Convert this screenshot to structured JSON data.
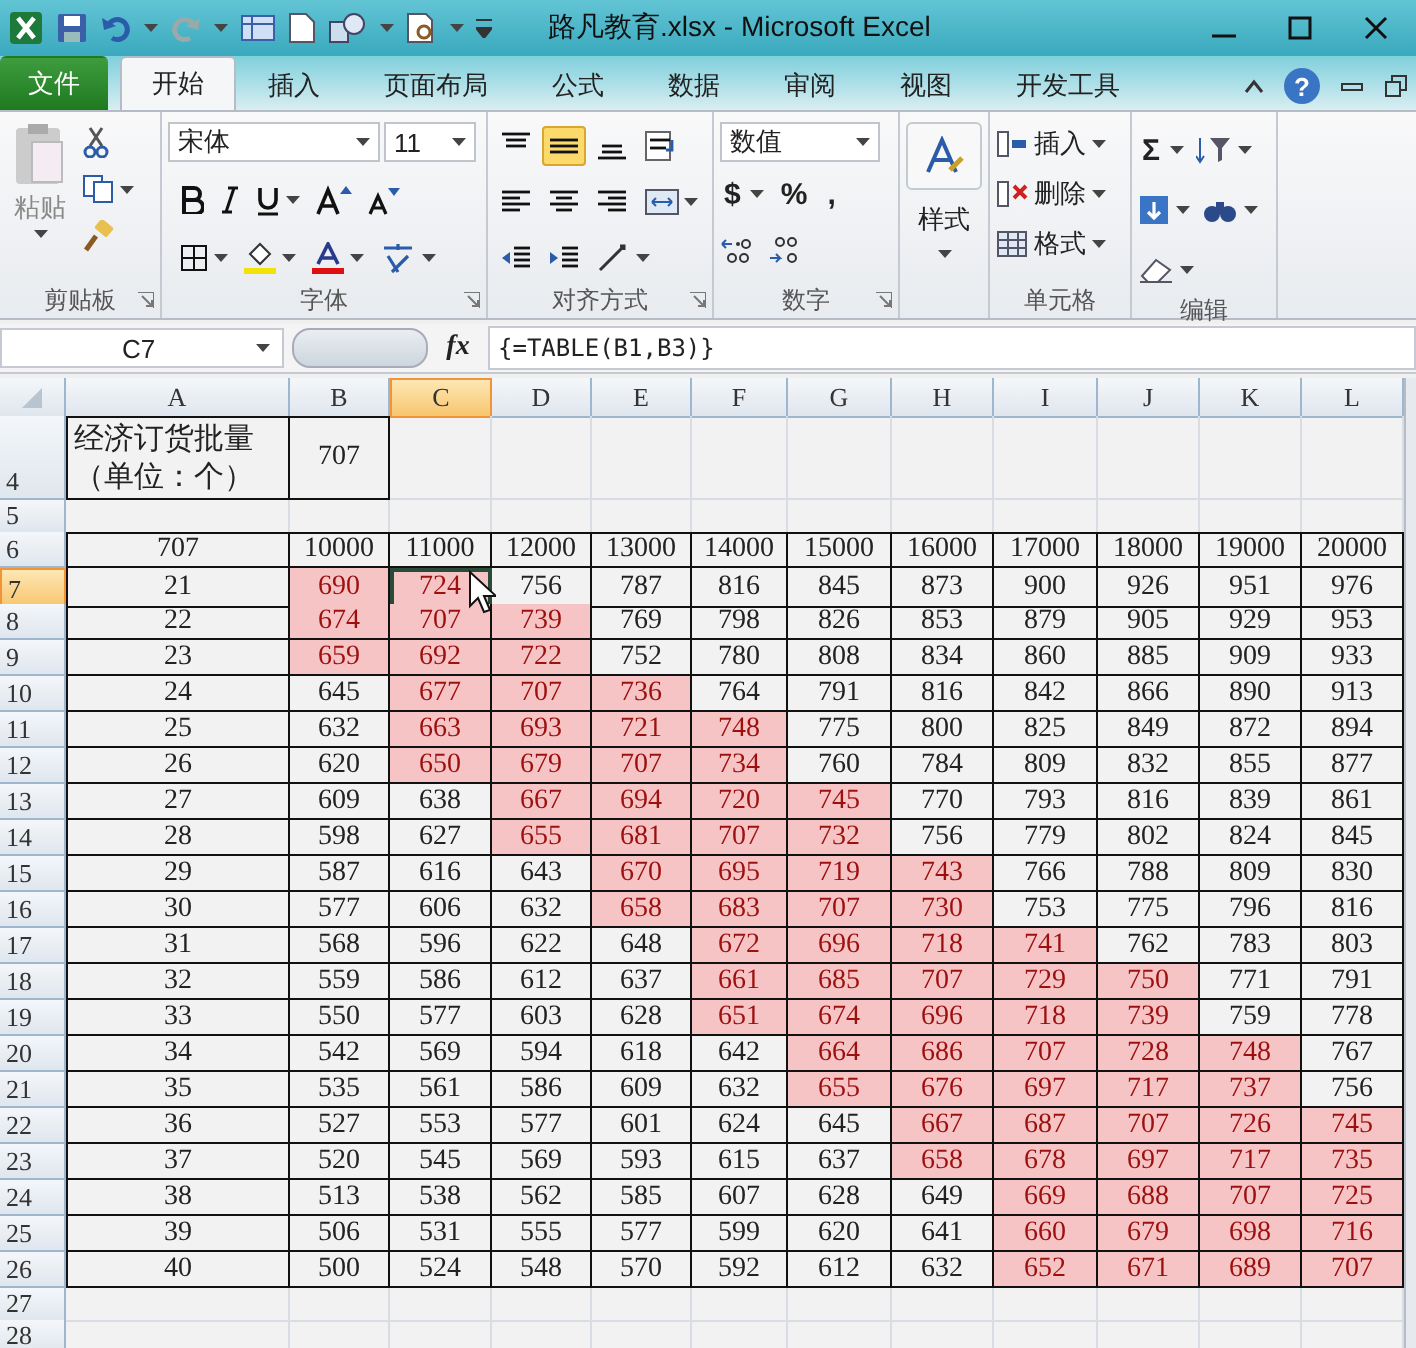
{
  "window": {
    "title": "路凡教育.xlsx - Microsoft Excel"
  },
  "ribbon_tabs": [
    {
      "label": "文件",
      "kind": "file",
      "selected": false
    },
    {
      "label": "开始",
      "kind": "tab",
      "selected": true
    },
    {
      "label": "插入",
      "kind": "tab",
      "selected": false
    },
    {
      "label": "页面布局",
      "kind": "tab",
      "selected": false
    },
    {
      "label": "公式",
      "kind": "tab",
      "selected": false
    },
    {
      "label": "数据",
      "kind": "tab",
      "selected": false
    },
    {
      "label": "审阅",
      "kind": "tab",
      "selected": false
    },
    {
      "label": "视图",
      "kind": "tab",
      "selected": false
    },
    {
      "label": "开发工具",
      "kind": "tab",
      "selected": false
    }
  ],
  "help": "?",
  "ribbon": {
    "clipboard": {
      "paste": "粘贴",
      "label": "剪贴板"
    },
    "font": {
      "name": "宋体",
      "size": "11",
      "label": "字体"
    },
    "alignment": {
      "label": "对齐方式",
      "buttons": [
        {
          "kind": "top",
          "on": false
        },
        {
          "kind": "middle",
          "on": true
        },
        {
          "kind": "bottom",
          "on": false
        },
        {
          "kind": "wrap",
          "on": false
        },
        {
          "kind": "left",
          "on": false
        },
        {
          "kind": "center",
          "on": false
        },
        {
          "kind": "right",
          "on": false
        },
        {
          "kind": "merge",
          "on": false
        },
        {
          "kind": "outdent",
          "on": false
        },
        {
          "kind": "indent",
          "on": false
        },
        {
          "kind": "orient",
          "on": false
        }
      ]
    },
    "number": {
      "format": "数值",
      "currency": "$",
      "percent": "%",
      "comma": ",",
      "label": "数字"
    },
    "styles": {
      "button": "样式"
    },
    "cells": {
      "insert": "插入",
      "delete": "删除",
      "format": "格式",
      "label": "单元格"
    },
    "editing": {
      "sum": "Σ",
      "label": "编辑"
    }
  },
  "formula_bar": {
    "name_box": "C7",
    "function_button": "fx",
    "formula": "{=TABLE(B1,B3)}"
  },
  "sheet": {
    "columns": [
      {
        "label": "A",
        "selected": false
      },
      {
        "label": "B",
        "selected": false
      },
      {
        "label": "C",
        "selected": true
      },
      {
        "label": "D",
        "selected": false
      },
      {
        "label": "E",
        "selected": false
      },
      {
        "label": "F",
        "selected": false
      },
      {
        "label": "G",
        "selected": false
      },
      {
        "label": "H",
        "selected": false
      },
      {
        "label": "I",
        "selected": false
      },
      {
        "label": "J",
        "selected": false
      },
      {
        "label": "K",
        "selected": false
      },
      {
        "label": "L",
        "selected": false
      }
    ],
    "rows": [
      {
        "number": "4",
        "kind": "input",
        "selected": false,
        "cells": [
          {
            "text": "经济订货批量（单位：个）",
            "highlighted": false
          },
          {
            "text": "707",
            "highlighted": false
          }
        ]
      },
      {
        "number": "5",
        "kind": "blank",
        "selected": false
      },
      {
        "number": "6",
        "kind": "header",
        "selected": false,
        "cells": [
          {
            "text": "707",
            "highlighted": false
          },
          {
            "text": "10000",
            "highlighted": false
          },
          {
            "text": "11000",
            "highlighted": false
          },
          {
            "text": "12000",
            "highlighted": false
          },
          {
            "text": "13000",
            "highlighted": false
          },
          {
            "text": "14000",
            "highlighted": false
          },
          {
            "text": "15000",
            "highlighted": false
          },
          {
            "text": "16000",
            "highlighted": false
          },
          {
            "text": "17000",
            "highlighted": false
          },
          {
            "text": "18000",
            "highlighted": false
          },
          {
            "text": "19000",
            "highlighted": false
          },
          {
            "text": "20000",
            "highlighted": false
          }
        ]
      },
      {
        "number": "7",
        "kind": "data",
        "selected": true,
        "cells": [
          {
            "text": "21",
            "highlighted": false
          },
          {
            "text": "690",
            "highlighted": true
          },
          {
            "text": "724",
            "highlighted": true
          },
          {
            "text": "756",
            "highlighted": false
          },
          {
            "text": "787",
            "highlighted": false
          },
          {
            "text": "816",
            "highlighted": false
          },
          {
            "text": "845",
            "highlighted": false
          },
          {
            "text": "873",
            "highlighted": false
          },
          {
            "text": "900",
            "highlighted": false
          },
          {
            "text": "926",
            "highlighted": false
          },
          {
            "text": "951",
            "highlighted": false
          },
          {
            "text": "976",
            "highlighted": false
          }
        ]
      },
      {
        "number": "8",
        "kind": "data",
        "selected": false,
        "cells": [
          {
            "text": "22",
            "highlighted": false
          },
          {
            "text": "674",
            "highlighted": true
          },
          {
            "text": "707",
            "highlighted": true
          },
          {
            "text": "739",
            "highlighted": true
          },
          {
            "text": "769",
            "highlighted": false
          },
          {
            "text": "798",
            "highlighted": false
          },
          {
            "text": "826",
            "highlighted": false
          },
          {
            "text": "853",
            "highlighted": false
          },
          {
            "text": "879",
            "highlighted": false
          },
          {
            "text": "905",
            "highlighted": false
          },
          {
            "text": "929",
            "highlighted": false
          },
          {
            "text": "953",
            "highlighted": false
          }
        ]
      },
      {
        "number": "9",
        "kind": "data",
        "selected": false,
        "cells": [
          {
            "text": "23",
            "highlighted": false
          },
          {
            "text": "659",
            "highlighted": true
          },
          {
            "text": "692",
            "highlighted": true
          },
          {
            "text": "722",
            "highlighted": true
          },
          {
            "text": "752",
            "highlighted": false
          },
          {
            "text": "780",
            "highlighted": false
          },
          {
            "text": "808",
            "highlighted": false
          },
          {
            "text": "834",
            "highlighted": false
          },
          {
            "text": "860",
            "highlighted": false
          },
          {
            "text": "885",
            "highlighted": false
          },
          {
            "text": "909",
            "highlighted": false
          },
          {
            "text": "933",
            "highlighted": false
          }
        ]
      },
      {
        "number": "10",
        "kind": "data",
        "selected": false,
        "cells": [
          {
            "text": "24",
            "highlighted": false
          },
          {
            "text": "645",
            "highlighted": false
          },
          {
            "text": "677",
            "highlighted": true
          },
          {
            "text": "707",
            "highlighted": true
          },
          {
            "text": "736",
            "highlighted": true
          },
          {
            "text": "764",
            "highlighted": false
          },
          {
            "text": "791",
            "highlighted": false
          },
          {
            "text": "816",
            "highlighted": false
          },
          {
            "text": "842",
            "highlighted": false
          },
          {
            "text": "866",
            "highlighted": false
          },
          {
            "text": "890",
            "highlighted": false
          },
          {
            "text": "913",
            "highlighted": false
          }
        ]
      },
      {
        "number": "11",
        "kind": "data",
        "selected": false,
        "cells": [
          {
            "text": "25",
            "highlighted": false
          },
          {
            "text": "632",
            "highlighted": false
          },
          {
            "text": "663",
            "highlighted": true
          },
          {
            "text": "693",
            "highlighted": true
          },
          {
            "text": "721",
            "highlighted": true
          },
          {
            "text": "748",
            "highlighted": true
          },
          {
            "text": "775",
            "highlighted": false
          },
          {
            "text": "800",
            "highlighted": false
          },
          {
            "text": "825",
            "highlighted": false
          },
          {
            "text": "849",
            "highlighted": false
          },
          {
            "text": "872",
            "highlighted": false
          },
          {
            "text": "894",
            "highlighted": false
          }
        ]
      },
      {
        "number": "12",
        "kind": "data",
        "selected": false,
        "cells": [
          {
            "text": "26",
            "highlighted": false
          },
          {
            "text": "620",
            "highlighted": false
          },
          {
            "text": "650",
            "highlighted": true
          },
          {
            "text": "679",
            "highlighted": true
          },
          {
            "text": "707",
            "highlighted": true
          },
          {
            "text": "734",
            "highlighted": true
          },
          {
            "text": "760",
            "highlighted": false
          },
          {
            "text": "784",
            "highlighted": false
          },
          {
            "text": "809",
            "highlighted": false
          },
          {
            "text": "832",
            "highlighted": false
          },
          {
            "text": "855",
            "highlighted": false
          },
          {
            "text": "877",
            "highlighted": false
          }
        ]
      },
      {
        "number": "13",
        "kind": "data",
        "selected": false,
        "cells": [
          {
            "text": "27",
            "highlighted": false
          },
          {
            "text": "609",
            "highlighted": false
          },
          {
            "text": "638",
            "highlighted": false
          },
          {
            "text": "667",
            "highlighted": true
          },
          {
            "text": "694",
            "highlighted": true
          },
          {
            "text": "720",
            "highlighted": true
          },
          {
            "text": "745",
            "highlighted": true
          },
          {
            "text": "770",
            "highlighted": false
          },
          {
            "text": "793",
            "highlighted": false
          },
          {
            "text": "816",
            "highlighted": false
          },
          {
            "text": "839",
            "highlighted": false
          },
          {
            "text": "861",
            "highlighted": false
          }
        ]
      },
      {
        "number": "14",
        "kind": "data",
        "selected": false,
        "cells": [
          {
            "text": "28",
            "highlighted": false
          },
          {
            "text": "598",
            "highlighted": false
          },
          {
            "text": "627",
            "highlighted": false
          },
          {
            "text": "655",
            "highlighted": true
          },
          {
            "text": "681",
            "highlighted": true
          },
          {
            "text": "707",
            "highlighted": true
          },
          {
            "text": "732",
            "highlighted": true
          },
          {
            "text": "756",
            "highlighted": false
          },
          {
            "text": "779",
            "highlighted": false
          },
          {
            "text": "802",
            "highlighted": false
          },
          {
            "text": "824",
            "highlighted": false
          },
          {
            "text": "845",
            "highlighted": false
          }
        ]
      },
      {
        "number": "15",
        "kind": "data",
        "selected": false,
        "cells": [
          {
            "text": "29",
            "highlighted": false
          },
          {
            "text": "587",
            "highlighted": false
          },
          {
            "text": "616",
            "highlighted": false
          },
          {
            "text": "643",
            "highlighted": false
          },
          {
            "text": "670",
            "highlighted": true
          },
          {
            "text": "695",
            "highlighted": true
          },
          {
            "text": "719",
            "highlighted": true
          },
          {
            "text": "743",
            "highlighted": true
          },
          {
            "text": "766",
            "highlighted": false
          },
          {
            "text": "788",
            "highlighted": false
          },
          {
            "text": "809",
            "highlighted": false
          },
          {
            "text": "830",
            "highlighted": false
          }
        ]
      },
      {
        "number": "16",
        "kind": "data",
        "selected": false,
        "cells": [
          {
            "text": "30",
            "highlighted": false
          },
          {
            "text": "577",
            "highlighted": false
          },
          {
            "text": "606",
            "highlighted": false
          },
          {
            "text": "632",
            "highlighted": false
          },
          {
            "text": "658",
            "highlighted": true
          },
          {
            "text": "683",
            "highlighted": true
          },
          {
            "text": "707",
            "highlighted": true
          },
          {
            "text": "730",
            "highlighted": true
          },
          {
            "text": "753",
            "highlighted": false
          },
          {
            "text": "775",
            "highlighted": false
          },
          {
            "text": "796",
            "highlighted": false
          },
          {
            "text": "816",
            "highlighted": false
          }
        ]
      },
      {
        "number": "17",
        "kind": "data",
        "selected": false,
        "cells": [
          {
            "text": "31",
            "highlighted": false
          },
          {
            "text": "568",
            "highlighted": false
          },
          {
            "text": "596",
            "highlighted": false
          },
          {
            "text": "622",
            "highlighted": false
          },
          {
            "text": "648",
            "highlighted": false
          },
          {
            "text": "672",
            "highlighted": true
          },
          {
            "text": "696",
            "highlighted": true
          },
          {
            "text": "718",
            "highlighted": true
          },
          {
            "text": "741",
            "highlighted": true
          },
          {
            "text": "762",
            "highlighted": false
          },
          {
            "text": "783",
            "highlighted": false
          },
          {
            "text": "803",
            "highlighted": false
          }
        ]
      },
      {
        "number": "18",
        "kind": "data",
        "selected": false,
        "cells": [
          {
            "text": "32",
            "highlighted": false
          },
          {
            "text": "559",
            "highlighted": false
          },
          {
            "text": "586",
            "highlighted": false
          },
          {
            "text": "612",
            "highlighted": false
          },
          {
            "text": "637",
            "highlighted": false
          },
          {
            "text": "661",
            "highlighted": true
          },
          {
            "text": "685",
            "highlighted": true
          },
          {
            "text": "707",
            "highlighted": true
          },
          {
            "text": "729",
            "highlighted": true
          },
          {
            "text": "750",
            "highlighted": true
          },
          {
            "text": "771",
            "highlighted": false
          },
          {
            "text": "791",
            "highlighted": false
          }
        ]
      },
      {
        "number": "19",
        "kind": "data",
        "selected": false,
        "cells": [
          {
            "text": "33",
            "highlighted": false
          },
          {
            "text": "550",
            "highlighted": false
          },
          {
            "text": "577",
            "highlighted": false
          },
          {
            "text": "603",
            "highlighted": false
          },
          {
            "text": "628",
            "highlighted": false
          },
          {
            "text": "651",
            "highlighted": true
          },
          {
            "text": "674",
            "highlighted": true
          },
          {
            "text": "696",
            "highlighted": true
          },
          {
            "text": "718",
            "highlighted": true
          },
          {
            "text": "739",
            "highlighted": true
          },
          {
            "text": "759",
            "highlighted": false
          },
          {
            "text": "778",
            "highlighted": false
          }
        ]
      },
      {
        "number": "20",
        "kind": "data",
        "selected": false,
        "cells": [
          {
            "text": "34",
            "highlighted": false
          },
          {
            "text": "542",
            "highlighted": false
          },
          {
            "text": "569",
            "highlighted": false
          },
          {
            "text": "594",
            "highlighted": false
          },
          {
            "text": "618",
            "highlighted": false
          },
          {
            "text": "642",
            "highlighted": false
          },
          {
            "text": "664",
            "highlighted": true
          },
          {
            "text": "686",
            "highlighted": true
          },
          {
            "text": "707",
            "highlighted": true
          },
          {
            "text": "728",
            "highlighted": true
          },
          {
            "text": "748",
            "highlighted": true
          },
          {
            "text": "767",
            "highlighted": false
          }
        ]
      },
      {
        "number": "21",
        "kind": "data",
        "selected": false,
        "cells": [
          {
            "text": "35",
            "highlighted": false
          },
          {
            "text": "535",
            "highlighted": false
          },
          {
            "text": "561",
            "highlighted": false
          },
          {
            "text": "586",
            "highlighted": false
          },
          {
            "text": "609",
            "highlighted": false
          },
          {
            "text": "632",
            "highlighted": false
          },
          {
            "text": "655",
            "highlighted": true
          },
          {
            "text": "676",
            "highlighted": true
          },
          {
            "text": "697",
            "highlighted": true
          },
          {
            "text": "717",
            "highlighted": true
          },
          {
            "text": "737",
            "highlighted": true
          },
          {
            "text": "756",
            "highlighted": false
          }
        ]
      },
      {
        "number": "22",
        "kind": "data",
        "selected": false,
        "cells": [
          {
            "text": "36",
            "highlighted": false
          },
          {
            "text": "527",
            "highlighted": false
          },
          {
            "text": "553",
            "highlighted": false
          },
          {
            "text": "577",
            "highlighted": false
          },
          {
            "text": "601",
            "highlighted": false
          },
          {
            "text": "624",
            "highlighted": false
          },
          {
            "text": "645",
            "highlighted": false
          },
          {
            "text": "667",
            "highlighted": true
          },
          {
            "text": "687",
            "highlighted": true
          },
          {
            "text": "707",
            "highlighted": true
          },
          {
            "text": "726",
            "highlighted": true
          },
          {
            "text": "745",
            "highlighted": true
          }
        ]
      },
      {
        "number": "23",
        "kind": "data",
        "selected": false,
        "cells": [
          {
            "text": "37",
            "highlighted": false
          },
          {
            "text": "520",
            "highlighted": false
          },
          {
            "text": "545",
            "highlighted": false
          },
          {
            "text": "569",
            "highlighted": false
          },
          {
            "text": "593",
            "highlighted": false
          },
          {
            "text": "615",
            "highlighted": false
          },
          {
            "text": "637",
            "highlighted": false
          },
          {
            "text": "658",
            "highlighted": true
          },
          {
            "text": "678",
            "highlighted": true
          },
          {
            "text": "697",
            "highlighted": true
          },
          {
            "text": "717",
            "highlighted": true
          },
          {
            "text": "735",
            "highlighted": true
          }
        ]
      },
      {
        "number": "24",
        "kind": "data",
        "selected": false,
        "cells": [
          {
            "text": "38",
            "highlighted": false
          },
          {
            "text": "513",
            "highlighted": false
          },
          {
            "text": "538",
            "highlighted": false
          },
          {
            "text": "562",
            "highlighted": false
          },
          {
            "text": "585",
            "highlighted": false
          },
          {
            "text": "607",
            "highlighted": false
          },
          {
            "text": "628",
            "highlighted": false
          },
          {
            "text": "649",
            "highlighted": false
          },
          {
            "text": "669",
            "highlighted": true
          },
          {
            "text": "688",
            "highlighted": true
          },
          {
            "text": "707",
            "highlighted": true
          },
          {
            "text": "725",
            "highlighted": true
          }
        ]
      },
      {
        "number": "25",
        "kind": "data",
        "selected": false,
        "cells": [
          {
            "text": "39",
            "highlighted": false
          },
          {
            "text": "506",
            "highlighted": false
          },
          {
            "text": "531",
            "highlighted": false
          },
          {
            "text": "555",
            "highlighted": false
          },
          {
            "text": "577",
            "highlighted": false
          },
          {
            "text": "599",
            "highlighted": false
          },
          {
            "text": "620",
            "highlighted": false
          },
          {
            "text": "641",
            "highlighted": false
          },
          {
            "text": "660",
            "highlighted": true
          },
          {
            "text": "679",
            "highlighted": true
          },
          {
            "text": "698",
            "highlighted": true
          },
          {
            "text": "716",
            "highlighted": true
          }
        ]
      },
      {
        "number": "26",
        "kind": "data",
        "selected": false,
        "cells": [
          {
            "text": "40",
            "highlighted": false
          },
          {
            "text": "500",
            "highlighted": false
          },
          {
            "text": "524",
            "highlighted": false
          },
          {
            "text": "548",
            "highlighted": false
          },
          {
            "text": "570",
            "highlighted": false
          },
          {
            "text": "592",
            "highlighted": false
          },
          {
            "text": "612",
            "highlighted": false
          },
          {
            "text": "632",
            "highlighted": false
          },
          {
            "text": "652",
            "highlighted": true
          },
          {
            "text": "671",
            "highlighted": true
          },
          {
            "text": "689",
            "highlighted": true
          },
          {
            "text": "707",
            "highlighted": true
          }
        ]
      },
      {
        "number": "27",
        "kind": "blank",
        "selected": false
      },
      {
        "number": "28",
        "kind": "blank",
        "selected": false
      }
    ]
  }
}
